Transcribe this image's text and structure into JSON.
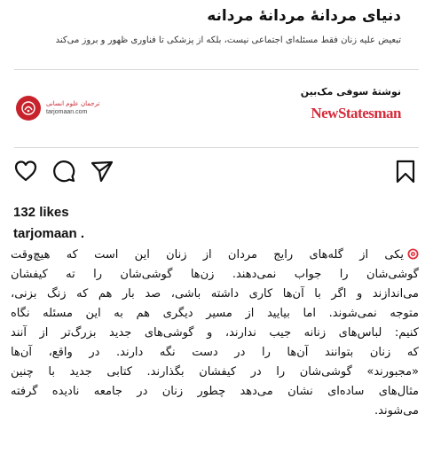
{
  "post": {
    "headline": "دنیای مردانهٔ مردانهٔ مردانه",
    "subhead": "تبعیض علیه زنان فقط مسئله‌ای اجتماعی نیست، بلکه از پزشکی تا فناوری ظهور و بروز می‌کند",
    "author": "نوشتهٔ سوفی مک‌بین",
    "source_logo": "NewStatesman",
    "publisher_name": "ترجمان علوم انسانی",
    "publisher_site": "tarjomaan.com",
    "colors": {
      "brand_red": "#d52b3a",
      "publisher_red": "#c8232c"
    }
  },
  "actions": {
    "icons": [
      "heart-icon",
      "comment-icon",
      "share-icon",
      "bookmark-icon"
    ]
  },
  "likes_text": "132 likes",
  "username": "tarjomaan .",
  "caption": {
    "lines": [
      "یکی از گله‌های رایج مردان از زنان این است که هیچ‌وقت",
      "گوشی‌شان را جواب نمی‌دهند. زن‌ها گوشی‌شان را ته کیفشان",
      "می‌اندازند و اگر با آن‌ها کاری داشته باشی، صد بار هم که زنگ بزنی،",
      "متوجه نمی‌شوند. اما بیایید از مسیر دیگری هم به این مسئله نگاه",
      "کنیم: لباس‌های زنانه جیب ندارند، و گوشی‌های جدید بزرگ‌تر از آنند",
      "که زنان بتوانند آن‌ها را در دست نگه دارند. در واقع، آن‌ها",
      "«مجبورند» گوشی‌شان را در کیفشان بگذارند. کتابی جدید با چنین",
      "مثال‌های ساده‌ای نشان می‌دهد چطور زنان در جامعه نادیده گرفته",
      "می‌شوند."
    ]
  }
}
